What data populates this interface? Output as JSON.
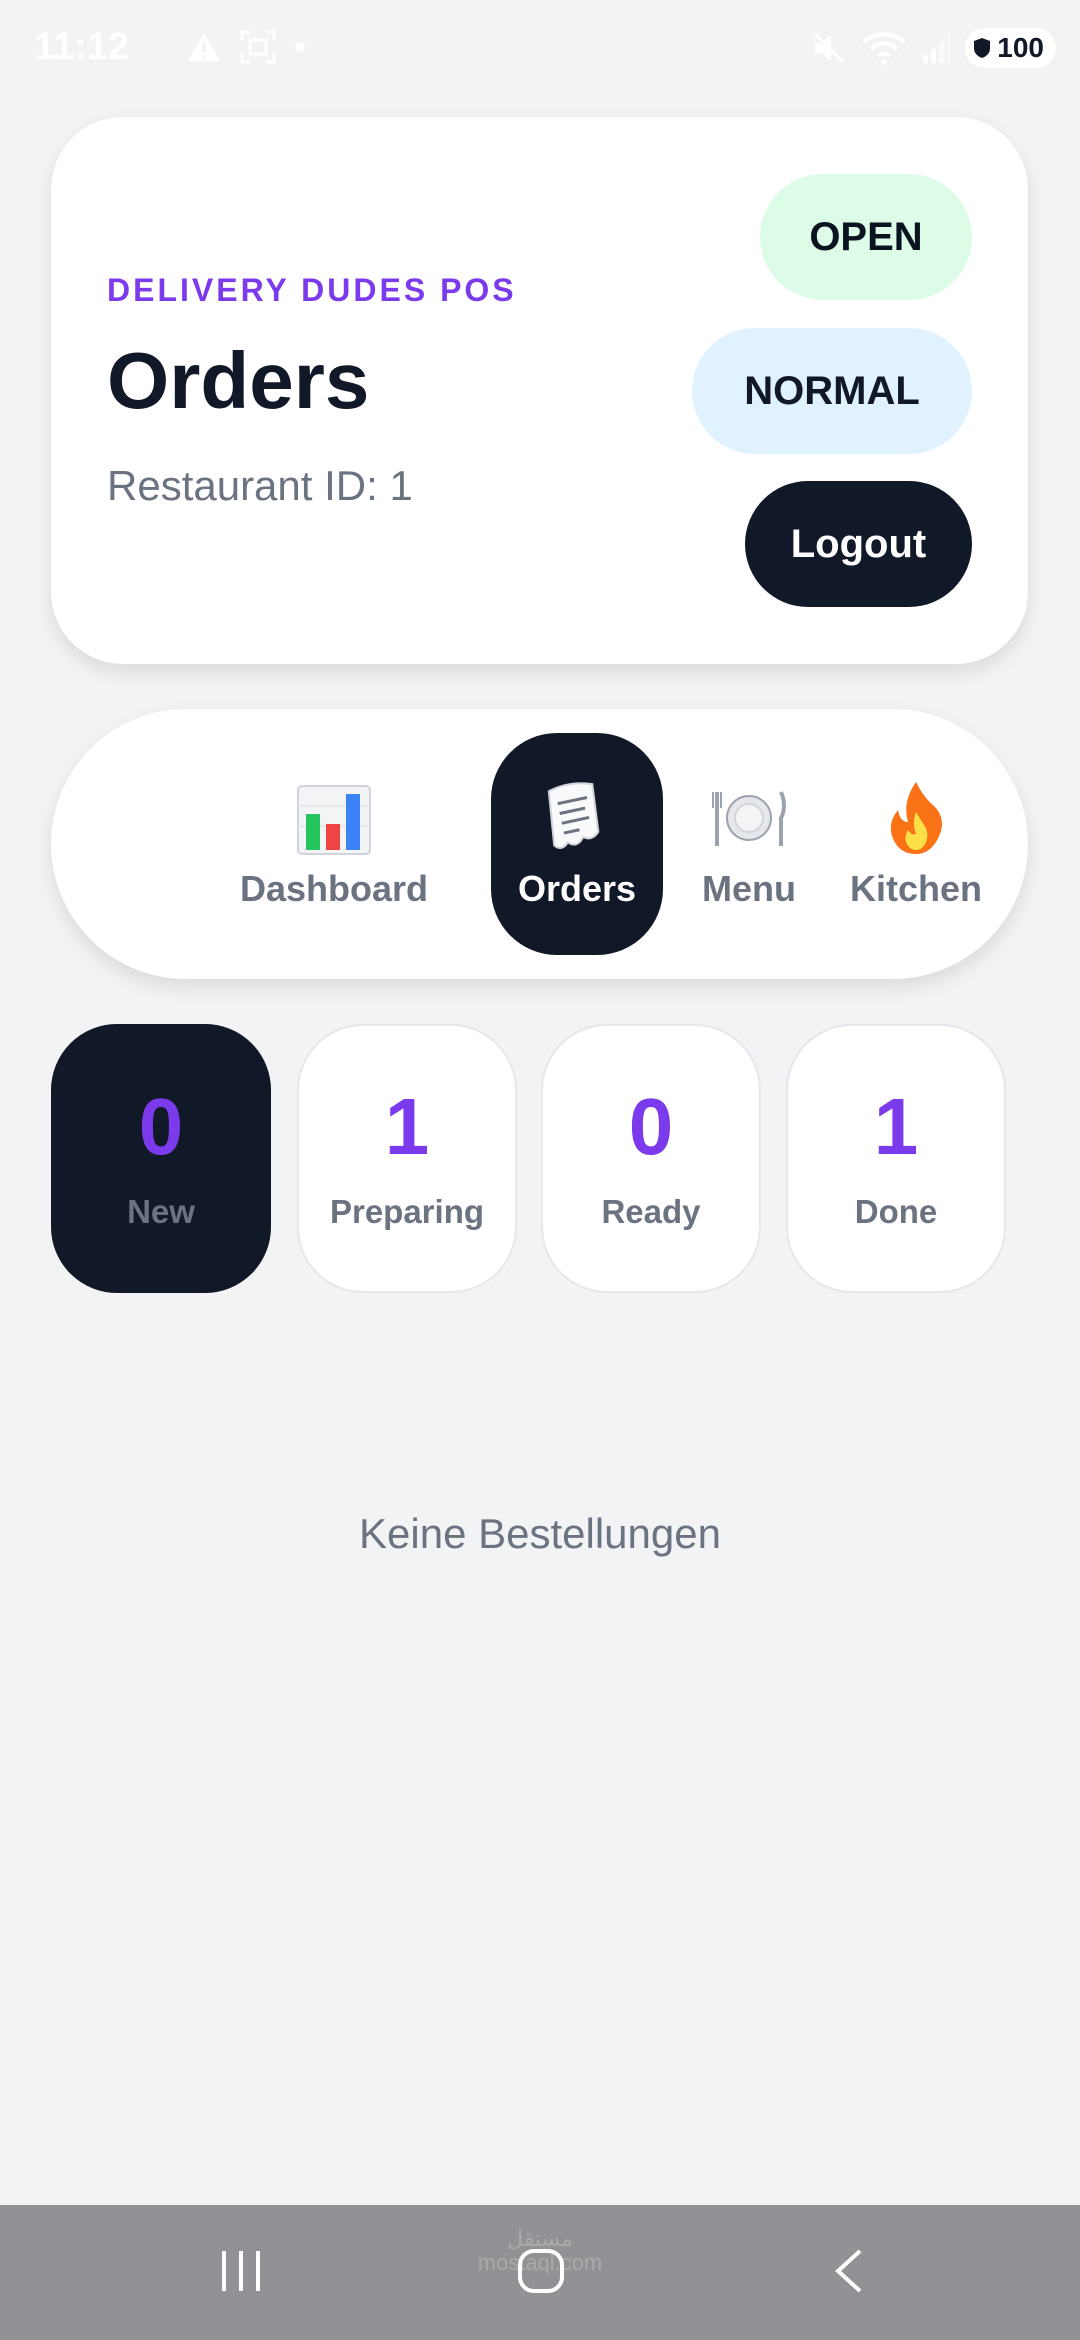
{
  "status_bar": {
    "time": "11:12",
    "battery": "100"
  },
  "header": {
    "brand": "DELIVERY DUDES POS",
    "title": "Orders",
    "restaurant_id": "Restaurant ID: 1",
    "status_open": "OPEN",
    "mode_normal": "NORMAL",
    "logout": "Logout"
  },
  "nav": {
    "items": [
      {
        "label": "Dashboard",
        "icon": "bar-chart-icon",
        "active": false
      },
      {
        "label": "Orders",
        "icon": "receipt-icon",
        "active": true
      },
      {
        "label": "Menu",
        "icon": "plate-icon",
        "active": false
      },
      {
        "label": "Kitchen",
        "icon": "fire-icon",
        "active": false
      }
    ]
  },
  "stats": [
    {
      "count": "0",
      "label": "New",
      "active": true
    },
    {
      "count": "1",
      "label": "Preparing",
      "active": false
    },
    {
      "count": "0",
      "label": "Ready",
      "active": false
    },
    {
      "count": "1",
      "label": "Done",
      "active": false
    }
  ],
  "empty_message": "Keine Bestellungen",
  "watermark": {
    "line1": "مستقل",
    "line2": "mostaql.com"
  },
  "colors": {
    "accent": "#7c3aed",
    "dark": "#111827",
    "open_bg": "#dcfce7",
    "normal_bg": "#e0f2fe",
    "page_bg": "#f2f3f5"
  }
}
